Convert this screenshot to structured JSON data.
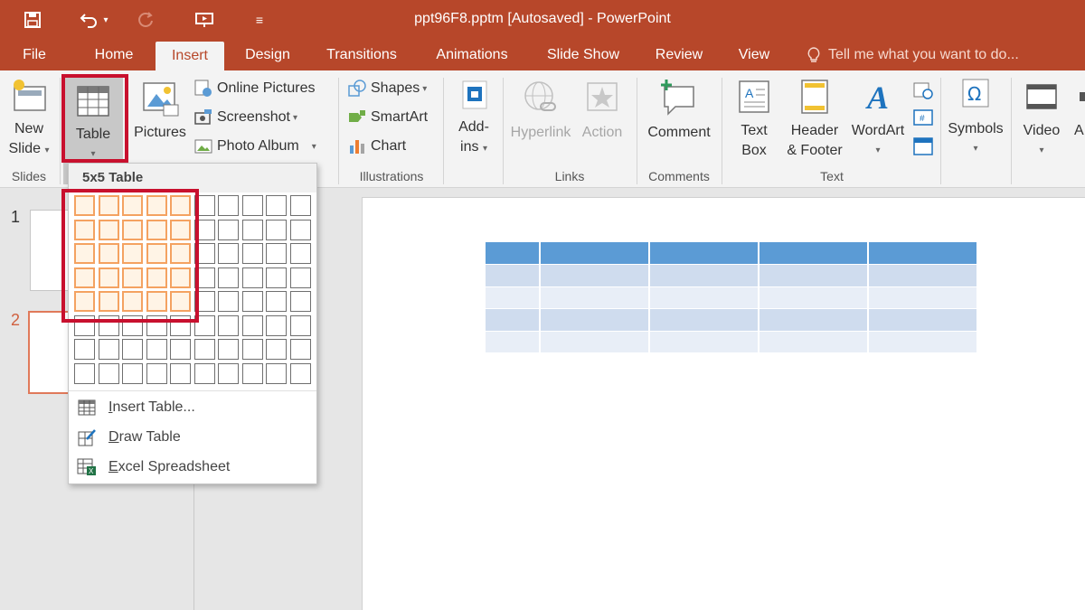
{
  "titlebar": {
    "title": "ppt96F8.pptm [Autosaved] - PowerPoint",
    "qat": [
      "save-icon",
      "undo-icon",
      "redo-icon",
      "present-icon",
      "customize-icon"
    ]
  },
  "tabs": {
    "file": "File",
    "home": "Home",
    "insert": "Insert",
    "design": "Design",
    "transitions": "Transitions",
    "animations": "Animations",
    "slideshow": "Slide Show",
    "review": "Review",
    "view": "View",
    "tellme": "Tell me what you want to do..."
  },
  "ribbon": {
    "slides": {
      "label": "Slides",
      "new_slide_1": "New",
      "new_slide_2": "Slide"
    },
    "tables": {
      "table": "Table"
    },
    "images": {
      "pictures": "Pictures",
      "online_pictures": "Online Pictures",
      "screenshot": "Screenshot",
      "photo_album": "Photo Album"
    },
    "illustrations": {
      "label": "Illustrations",
      "shapes": "Shapes",
      "smartart": "SmartArt",
      "chart": "Chart"
    },
    "addins": {
      "line1": "Add-",
      "line2": "ins"
    },
    "links": {
      "label": "Links",
      "hyperlink": "Hyperlink",
      "action": "Action"
    },
    "comments": {
      "label": "Comments",
      "comment": "Comment"
    },
    "text": {
      "label": "Text",
      "textbox_1": "Text",
      "textbox_2": "Box",
      "header_1": "Header",
      "header_2": "& Footer",
      "wordart": "WordArt"
    },
    "symbols": {
      "symbols": "Symbols"
    },
    "media": {
      "video": "Video",
      "audio_partial": "A"
    }
  },
  "dropdown": {
    "header": "5x5 Table",
    "grid": {
      "cols": 10,
      "rows": 8,
      "selected_cols": 5,
      "selected_rows": 5
    },
    "items": [
      {
        "prefix": "",
        "underline": "I",
        "rest": "nsert Table...",
        "icon": "insert-table-icon"
      },
      {
        "prefix": "",
        "underline": "D",
        "rest": "raw Table",
        "icon": "draw-table-icon"
      },
      {
        "prefix": "",
        "underline": "E",
        "rest": "xcel Spreadsheet",
        "icon": "excel-spreadsheet-icon"
      }
    ]
  },
  "thumbnails": {
    "slide1": "1",
    "slide2": "2"
  },
  "colors": {
    "accent": "#b7472a",
    "highlight": "#c8102e",
    "table_header": "#5b9bd5",
    "table_band_dark": "#cfdcee",
    "table_band_light": "#e8eef7",
    "grid_selected": "#f4a261"
  }
}
